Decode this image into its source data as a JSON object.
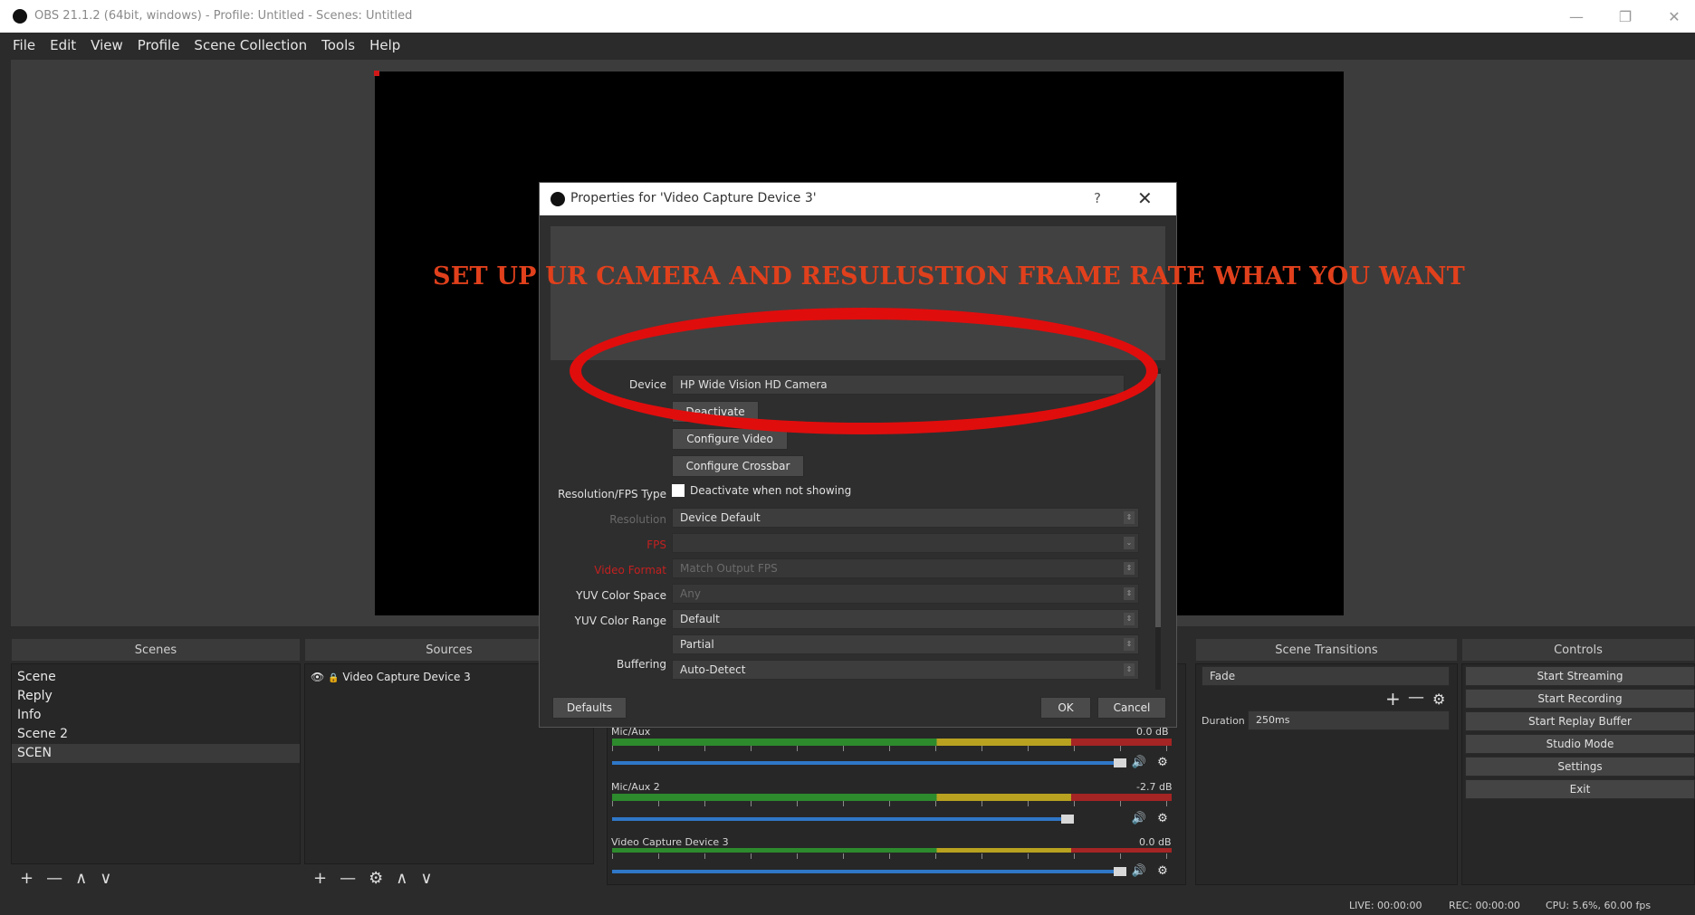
{
  "window": {
    "title": "OBS 21.1.2 (64bit, windows) - Profile: Untitled - Scenes: Untitled",
    "minimize": "—",
    "maximize": "❐",
    "close": "✕"
  },
  "menu": [
    "File",
    "Edit",
    "View",
    "Profile",
    "Scene Collection",
    "Tools",
    "Help"
  ],
  "scenes": {
    "title": "Scenes",
    "items": [
      "Scene",
      "Reply",
      "Info",
      "Scene 2",
      "SCEN"
    ],
    "toolbar": [
      "+",
      "—",
      "∧",
      "∨"
    ]
  },
  "sources": {
    "title": "Sources",
    "items": [
      "Video Capture Device 3"
    ],
    "toolbar": [
      "+",
      "—",
      "⚙",
      "∧",
      "∨"
    ]
  },
  "mixer": {
    "channels": [
      {
        "name": "Mic/Aux",
        "db": "0.0 dB"
      },
      {
        "name": "Mic/Aux 2",
        "db": "-2.7 dB"
      },
      {
        "name": "Video Capture Device 3",
        "db": "0.0 dB"
      }
    ]
  },
  "transitions": {
    "title": "Scene Transitions",
    "selected": "Fade",
    "add": "+",
    "remove": "—",
    "duration_label": "Duration",
    "duration_value": "250ms"
  },
  "controls": {
    "title": "Controls",
    "buttons": [
      "Start Streaming",
      "Start Recording",
      "Start Replay Buffer",
      "Studio Mode",
      "Settings",
      "Exit"
    ]
  },
  "status": {
    "live": "LIVE: 00:00:00",
    "rec": "REC: 00:00:00",
    "cpu": "CPU: 5.6%, 60.00 fps"
  },
  "dialog": {
    "title": "Properties for 'Video Capture Device 3'",
    "help": "?",
    "close": "✕",
    "device_label": "Device",
    "device_value": "HP Wide Vision HD Camera",
    "deactivate_btn": "Deactivate",
    "configure_video": "Configure Video",
    "configure_crossbar": "Configure Crossbar",
    "deactivate_checkbox": "Deactivate when not showing",
    "res_type_label": "Resolution/FPS Type",
    "res_type_value": "Device Default",
    "resolution_label": "Resolution",
    "resolution_value": "",
    "fps_label": "FPS",
    "fps_value": "Match Output FPS",
    "video_format_label": "Video Format",
    "video_format_value": "Any",
    "yuv_space_label": "YUV Color Space",
    "yuv_space_value": "Default",
    "yuv_range_label": "YUV Color Range",
    "yuv_range_value": "Partial",
    "buffering_label": "Buffering",
    "buffering_value": "Auto-Detect",
    "defaults_btn": "Defaults",
    "ok_btn": "OK",
    "cancel_btn": "Cancel"
  },
  "annotation": {
    "caption": "SET UP UR CAMERA AND RESULUSTION FRAME RATE WHAT YOU WANT",
    "color": "#e0401c",
    "ellipse_color": "#e00d0d"
  }
}
